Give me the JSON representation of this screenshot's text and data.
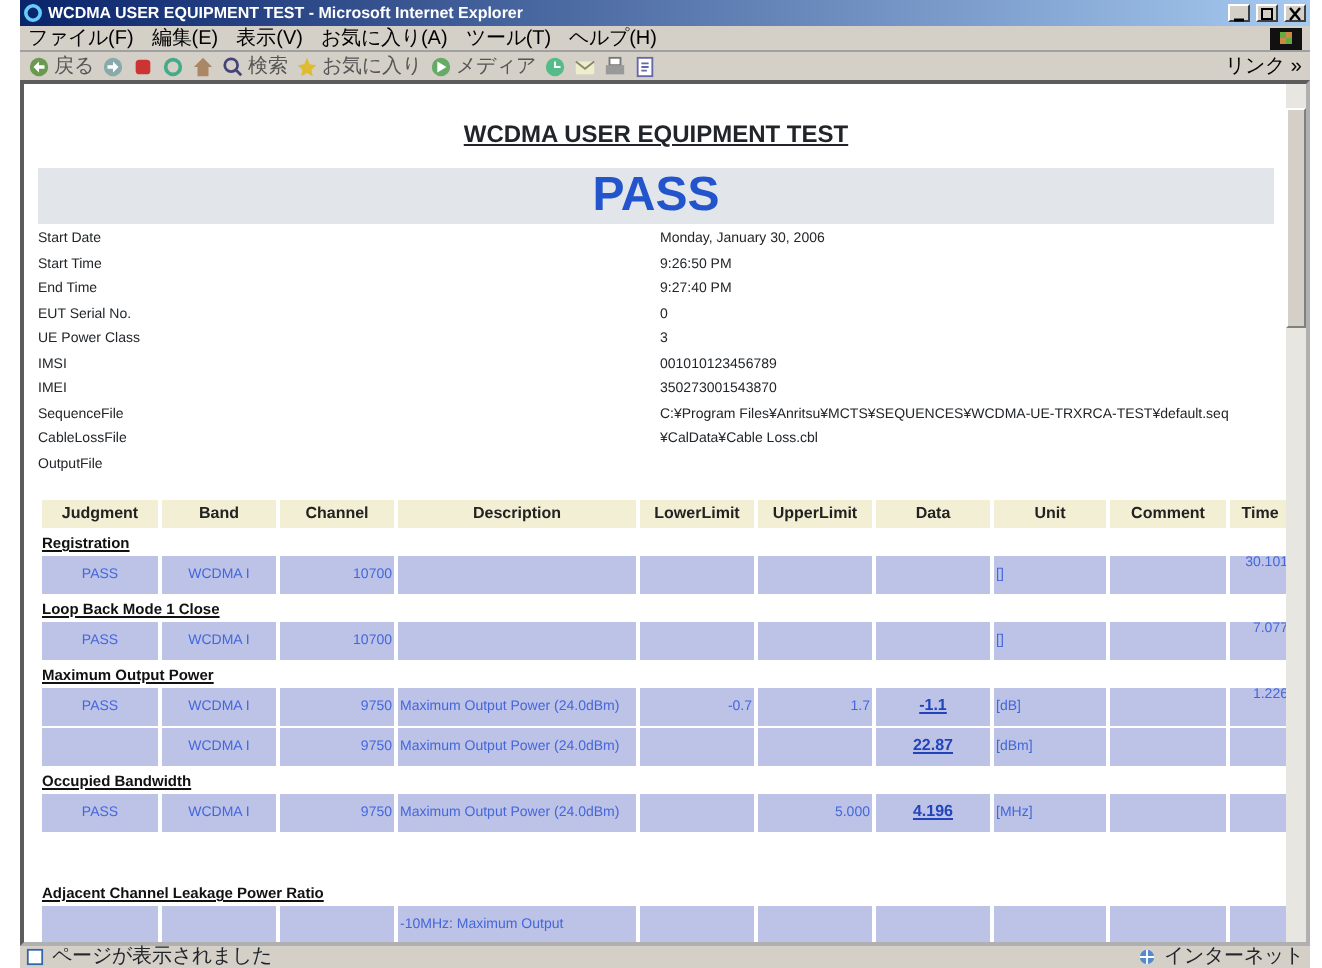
{
  "window": {
    "title": "WCDMA USER EQUIPMENT TEST - Microsoft Internet Explorer",
    "menu": [
      "ファイル(F)",
      "編集(E)",
      "表示(V)",
      "お気に入り(A)",
      "ツール(T)",
      "ヘルプ(H)"
    ],
    "toolbar": [
      {
        "kind": "back",
        "label": "戻る"
      },
      {
        "kind": "forward"
      },
      {
        "kind": "stop"
      },
      {
        "kind": "refresh"
      },
      {
        "kind": "home"
      },
      {
        "kind": "search",
        "label": "検索"
      },
      {
        "kind": "favorites",
        "label": "お気に入り"
      },
      {
        "kind": "media",
        "label": "メディア"
      },
      {
        "kind": "history"
      },
      {
        "kind": "mail"
      },
      {
        "kind": "print"
      },
      {
        "kind": "edit"
      }
    ],
    "links": "リンク »"
  },
  "report": {
    "title": "WCDMA USER EQUIPMENT TEST",
    "result": "PASS",
    "info": [
      {
        "label": "Start Date",
        "value": "Monday, January 30, 2006"
      },
      {
        "label": "Start Time",
        "value": "9:26:50 PM"
      },
      {
        "label": "End Time",
        "value": "9:27:40 PM"
      },
      {
        "label": "EUT Serial No.",
        "value": "0"
      },
      {
        "label": "UE Power Class",
        "value": "3"
      },
      {
        "label": "IMSI",
        "value": "001010123456789"
      },
      {
        "label": "IMEI",
        "value": "350273001543870"
      },
      {
        "label": "SequenceFile",
        "value": "C:¥Program Files¥Anritsu¥MCTS¥SEQUENCES¥WCDMA-UE-TRXRCA-TEST¥default.seq"
      },
      {
        "label": "CableLossFile",
        "value": "¥CalData¥Cable Loss.cbl"
      },
      {
        "label": "OutputFile"
      }
    ],
    "columns": [
      "Judgment",
      "Band",
      "Channel",
      "Description",
      "LowerLimit",
      "UpperLimit",
      "Data",
      "Unit",
      "Comment",
      "Time"
    ],
    "sections": [
      {
        "title": "Registration",
        "rows": [
          {
            "judgment": "PASS",
            "band": "WCDMA I",
            "channel": "10700",
            "unit": "[]",
            "time": "30.101"
          }
        ]
      },
      {
        "title": "Loop Back Mode 1 Close",
        "rows": [
          {
            "judgment": "PASS",
            "band": "WCDMA I",
            "channel": "10700",
            "unit": "[]",
            "time": "7.077"
          }
        ]
      },
      {
        "title": "Maximum Output Power",
        "rows": [
          {
            "judgment": "PASS",
            "band": "WCDMA I",
            "channel": "9750",
            "description": "Maximum Output Power (24.0dBm)",
            "lower_limit": "-0.7",
            "upper_limit": "1.7",
            "data": "-1.1",
            "unit": "[dB]",
            "time": "1.226"
          },
          {
            "band": "WCDMA I",
            "channel": "9750",
            "description": "Maximum Output Power (24.0dBm)",
            "data": "22.87",
            "unit": "[dBm]"
          }
        ]
      },
      {
        "title": "Occupied Bandwidth",
        "rows": [
          {
            "judgment": "PASS",
            "band": "WCDMA I",
            "channel": "9750",
            "description": "Maximum Output Power (24.0dBm)",
            "upper_limit": "5.000",
            "data": "4.196",
            "unit": "[MHz]"
          }
        ]
      },
      {
        "title": "Adjacent Channel Leakage Power Ratio",
        "gap": true,
        "rows": [
          {
            "description": "-10MHz: Maximum Output"
          }
        ]
      }
    ]
  },
  "status_bar": {
    "text": "ページが表示されました",
    "zone": "インターネット"
  }
}
